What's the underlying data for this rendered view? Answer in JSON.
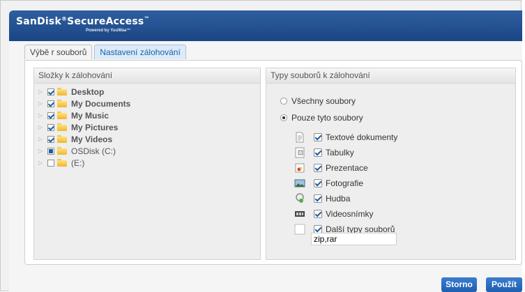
{
  "header": {
    "brand_main": "SanDisk",
    "brand_reg": "®",
    "brand_product": "SecureAccess",
    "brand_tm": "™",
    "brand_sub": "Powered by YuuWaa™"
  },
  "tabs": [
    {
      "label": "Výbě r souborů",
      "active": false
    },
    {
      "label": "Nastavení zálohování",
      "active": true
    }
  ],
  "folders_panel": {
    "title": "Složky k zálohování",
    "items": [
      {
        "label": "Desktop",
        "state": "checked",
        "bold": true
      },
      {
        "label": "My Documents",
        "state": "checked",
        "bold": true
      },
      {
        "label": "My Music",
        "state": "checked",
        "bold": true
      },
      {
        "label": "My Pictures",
        "state": "checked",
        "bold": true
      },
      {
        "label": "My Videos",
        "state": "checked",
        "bold": true
      },
      {
        "label": "OSDisk (C:)",
        "state": "partial",
        "bold": false
      },
      {
        "label": "(E:)",
        "state": "unchecked",
        "bold": false
      }
    ]
  },
  "types_panel": {
    "title": "Typy souborů  k zálohování",
    "radio_all": "Všechny soubory",
    "radio_only": "Pouze tyto soubory",
    "selected": "only",
    "types": [
      {
        "label": "Textové dokumenty",
        "icon": "text-document-icon",
        "checked": true
      },
      {
        "label": "Tabulky",
        "icon": "spreadsheet-icon",
        "checked": true
      },
      {
        "label": "Prezentace",
        "icon": "presentation-icon",
        "checked": true
      },
      {
        "label": "Fotografie",
        "icon": "photo-icon",
        "checked": true
      },
      {
        "label": "Hudba",
        "icon": "music-icon",
        "checked": true
      },
      {
        "label": "Videosnímky",
        "icon": "video-icon",
        "checked": true
      },
      {
        "label": "Další typy souborů",
        "icon": "blank-file-icon",
        "checked": true
      }
    ],
    "other_extensions": "zip,rar"
  },
  "buttons": {
    "cancel": "Storno",
    "use": "Použít"
  },
  "colors": {
    "header": "#1b4584",
    "accent": "#1f5fb1",
    "tab_active_text": "#1c5fa8"
  }
}
